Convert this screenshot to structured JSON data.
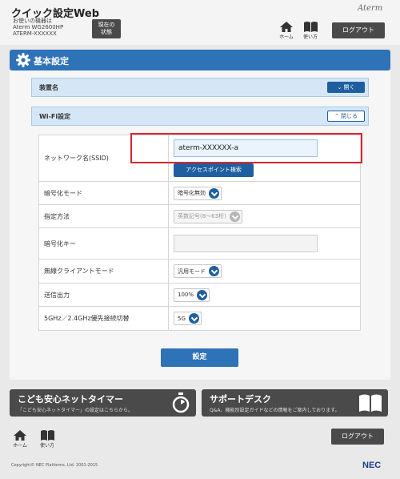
{
  "header": {
    "app_title": "クイック設定Web",
    "device_line1": "お使いの機器は",
    "device_line2": "Aterm WG2600HP",
    "device_line3": "ATERM-XXXXXX",
    "status_btn_line1": "現在の",
    "status_btn_line2": "状態",
    "brand": "Aterm",
    "home_label": "ホーム",
    "help_label": "使い方",
    "logout_label": "ログアウト"
  },
  "section": {
    "title": "基本設定"
  },
  "accordions": [
    {
      "label": "装置名",
      "button": "開く",
      "state": "collapsed"
    },
    {
      "label": "Wi-Fi設定",
      "button": "閉じる",
      "state": "expanded"
    }
  ],
  "form": {
    "ssid_label": "ネットワーク名(SSID)",
    "ssid_value": "aterm-XXXXXX-a",
    "scan_button": "アクセスポイント検索",
    "encryption_label": "暗号化モード",
    "encryption_value": "暗号化無効",
    "method_label": "指定方法",
    "method_value": "英数記号(8〜63桁)",
    "key_label": "暗号化キー",
    "key_value": "",
    "client_mode_label": "無線クライアントモード",
    "client_mode_value": "汎用モード",
    "tx_power_label": "送信出力",
    "tx_power_value": "100%",
    "band_label": "5GHz／2.4GHz優先接続切替",
    "band_value": "5G"
  },
  "save_button": "設定",
  "banners": {
    "timer_title": "こども安心ネットタイマー",
    "timer_desc": "「こども安心ネットタイマー」の設定はこちらから。",
    "support_title": "サポートデスク",
    "support_desc": "Q&A、機能別設定ガイドなどの情報をご案内しております。"
  },
  "footer": {
    "home_label": "ホーム",
    "help_label": "使い方",
    "logout_label": "ログアウト",
    "copyright": "Copyright© NEC Platforms, Ltd. 2001-2015",
    "nec_logo": "NEC"
  },
  "colors": {
    "accent": "#2e72b8",
    "highlight": "#d8262e",
    "dark_button": "#4a4a4a"
  }
}
